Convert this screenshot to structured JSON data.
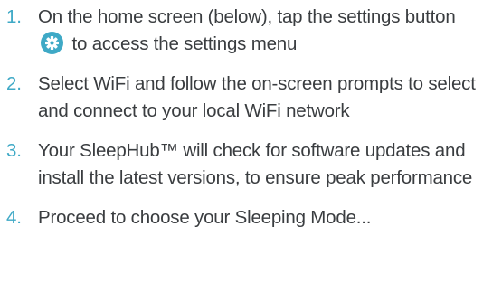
{
  "colors": {
    "accent": "#3fa9c6",
    "text": "#3a3d40",
    "icon_bg": "#3fa9c6",
    "icon_fg": "#ffffff"
  },
  "steps": [
    {
      "number": "1.",
      "text_before_icon": "On the home screen (below), tap the settings button",
      "icon": "gear-icon",
      "text_after_icon": "to access the settings menu"
    },
    {
      "number": "2.",
      "text": "Select WiFi and follow the on-screen prompts to select and connect to your local WiFi network"
    },
    {
      "number": "3.",
      "text": "Your SleepHub™ will check for software updates and install the latest versions, to ensure peak performance"
    },
    {
      "number": "4.",
      "text": "Proceed to choose your Sleeping Mode..."
    }
  ]
}
